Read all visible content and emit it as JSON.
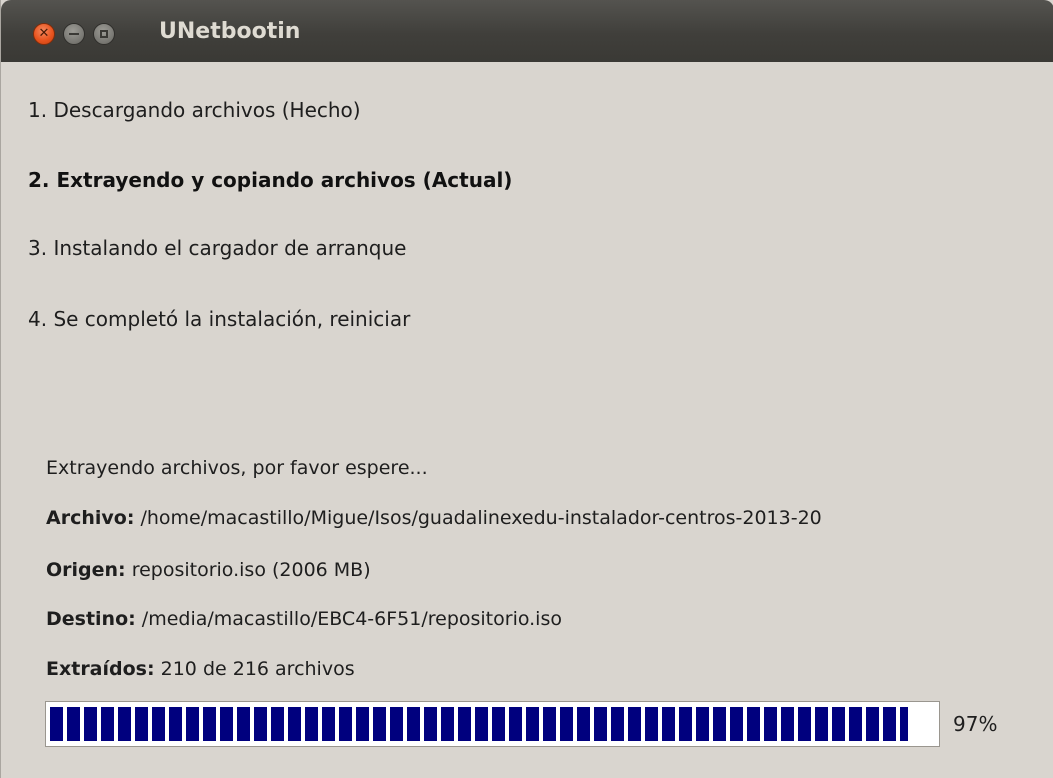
{
  "window": {
    "title": "UNetbootin",
    "controls": [
      "close-icon",
      "minimize-icon",
      "maximize-icon"
    ]
  },
  "steps": [
    {
      "label": "1. Descargando archivos (Hecho)",
      "state": "done"
    },
    {
      "label": "2. Extrayendo y copiando archivos (Actual)",
      "state": "current"
    },
    {
      "label": "3. Instalando el cargador de arranque",
      "state": "pending"
    },
    {
      "label": "4. Se completó la instalación, reiniciar",
      "state": "pending"
    }
  ],
  "status": {
    "message": "Extrayendo archivos, por favor espere...",
    "archivo_label": "Archivo:",
    "archivo_value": " /home/macastillo/Migue/Isos/guadalinexedu-instalador-centros-2013-20",
    "origen_label": "Origen:",
    "origen_value": " repositorio.iso (2006 MB)",
    "destino_label": "Destino:",
    "destino_value": " /media/macastillo/EBC4-6F51/repositorio.iso",
    "extraidos_label": "Extraídos:",
    "extraidos_value": " 210 de 216 archivos"
  },
  "progress": {
    "percent_text": "97%",
    "value": 0.97,
    "color": "#00007e"
  }
}
